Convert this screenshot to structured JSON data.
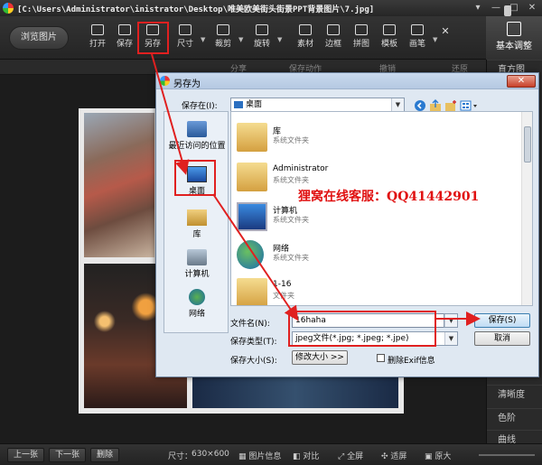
{
  "window": {
    "title": "[C:\\Users\\Administrator\\inistrator\\Desktop\\唯美欧美街头街景PPT背景图片\\7.jpg]",
    "controls": [
      "▾",
      "—",
      "□",
      "✕"
    ]
  },
  "toolbar": {
    "browse_label": "浏览图片",
    "tools": [
      {
        "label": "打开",
        "icon": "folder-open-icon"
      },
      {
        "label": "保存",
        "icon": "save-icon"
      },
      {
        "label": "另存",
        "icon": "save-as-icon"
      },
      {
        "label": "尺寸",
        "icon": "resize-icon"
      },
      {
        "label": "裁剪",
        "icon": "crop-icon"
      },
      {
        "label": "旋转",
        "icon": "rotate-icon"
      },
      {
        "label": "素材",
        "icon": "material-icon"
      },
      {
        "label": "边框",
        "icon": "border-icon"
      },
      {
        "label": "拼图",
        "icon": "collage-icon"
      },
      {
        "label": "模板",
        "icon": "template-icon"
      },
      {
        "label": "画笔",
        "icon": "brush-icon"
      }
    ]
  },
  "substrip": {
    "items": [
      "分享",
      "保存动作",
      "撤销",
      "还原"
    ]
  },
  "right_panel": {
    "header": "基本调整",
    "items": [
      "直方图",
      "清晰度",
      "色阶",
      "曲线"
    ]
  },
  "bottom_bar": {
    "prev": "上一张",
    "next": "下一张",
    "delete": "删除",
    "size_label": "尺寸：",
    "size_value": "630×600",
    "info": "图片信息",
    "compare": "对比",
    "fullscreen": "全屏",
    "fit": "适屏",
    "original": "原大"
  },
  "dialog": {
    "title": "另存为",
    "save_in_label": "保存在(I):",
    "save_in_value": "桌面",
    "places": [
      "最近访问的位置",
      "桌面",
      "库",
      "计算机",
      "网络"
    ],
    "files": [
      {
        "name": "库",
        "sub": "系统文件夹"
      },
      {
        "name": "Administrator",
        "sub": "系统文件夹"
      },
      {
        "name": "计算机",
        "sub": "系统文件夹"
      },
      {
        "name": "网络",
        "sub": "系统文件夹"
      },
      {
        "name": "1-16",
        "sub": "文件夹"
      }
    ],
    "filename_label": "文件名(N):",
    "filename_value": "16haha",
    "filetype_label": "保存类型(T):",
    "filetype_value": "jpeg文件(*.jpg; *.jpeg; *.jpe)",
    "savesize_label": "保存大小(S):",
    "modify_size_label": "修改大小 >>",
    "delete_exif_label": "删除Exif信息",
    "save_btn": "保存(S)",
    "cancel_btn": "取消"
  },
  "watermark": "狸窝在线客服：QQ41442901",
  "colors": {
    "highlight": "#e02020",
    "dialog_bg": "#dfe8f2",
    "app_bg": "#1f1f1f"
  }
}
